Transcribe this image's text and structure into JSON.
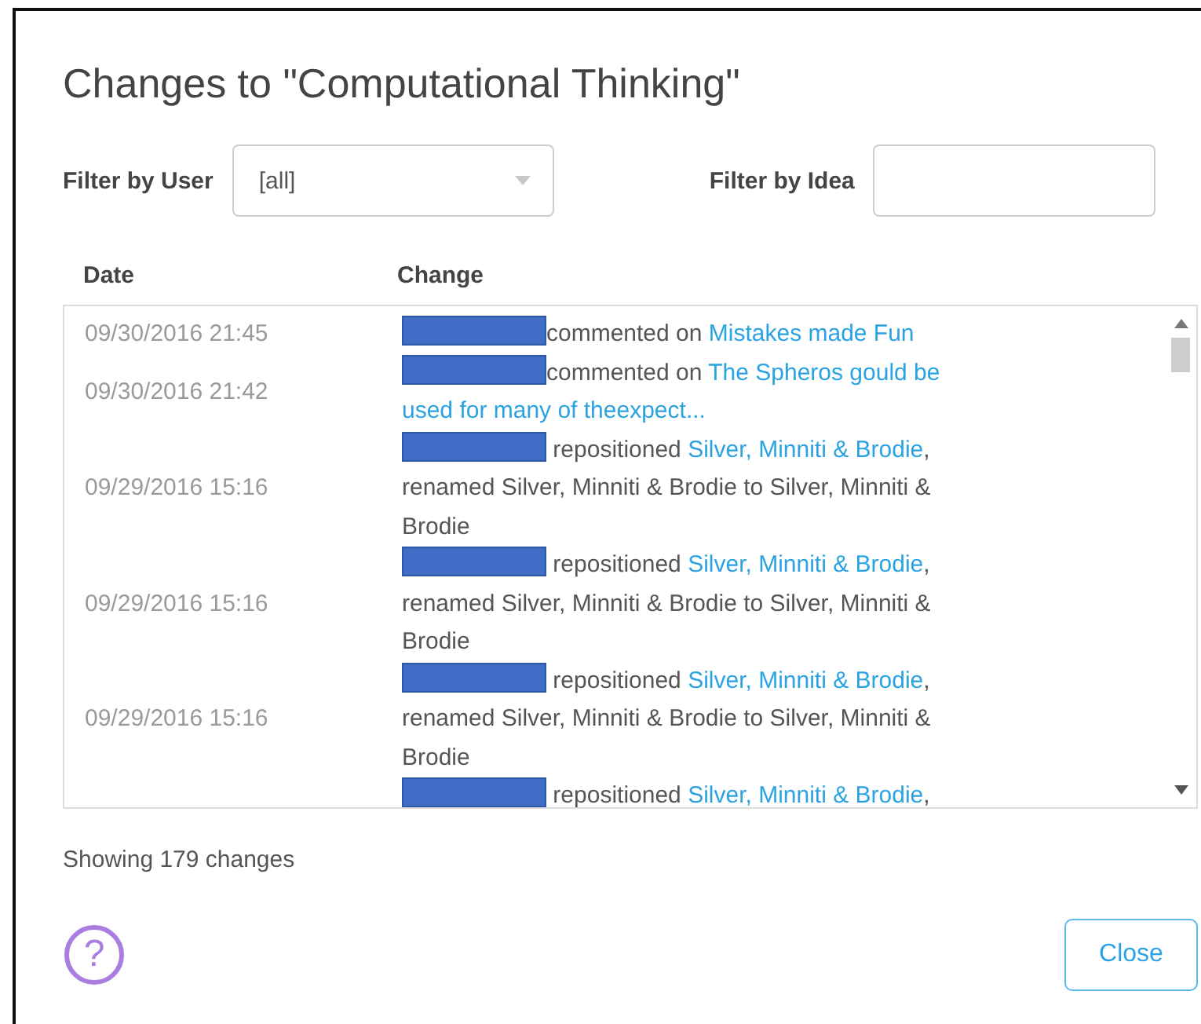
{
  "dialog": {
    "title": "Changes to \"Computational Thinking\"",
    "filters": {
      "user_label": "Filter by User",
      "user_value": "[all]",
      "idea_label": "Filter by Idea"
    },
    "table": {
      "columns": [
        "Date",
        "Change"
      ],
      "rows": [
        {
          "date": "09/30/2016 21:45",
          "lines": [
            [
              {
                "kind": "redacted"
              },
              {
                "kind": "text",
                "text": "commented on "
              },
              {
                "kind": "link",
                "text": "Mistakes made Fun"
              }
            ]
          ]
        },
        {
          "date": "09/30/2016 21:42",
          "lines": [
            [
              {
                "kind": "redacted"
              },
              {
                "kind": "text",
                "text": "commented on "
              },
              {
                "kind": "link",
                "text": "The Spheros gould be"
              }
            ],
            [
              {
                "kind": "link",
                "text": "used for many of theexpect..."
              }
            ]
          ]
        },
        {
          "date": "09/29/2016 15:16",
          "lines": [
            [
              {
                "kind": "redacted"
              },
              {
                "kind": "text",
                "text": " repositioned "
              },
              {
                "kind": "link",
                "text": "Silver, Minniti & Brodie"
              },
              {
                "kind": "text",
                "text": ","
              }
            ],
            [
              {
                "kind": "text",
                "text": "renamed Silver, Minniti & Brodie to Silver, Minniti &"
              }
            ],
            [
              {
                "kind": "text",
                "text": "Brodie"
              }
            ]
          ]
        },
        {
          "date": "09/29/2016 15:16",
          "lines": [
            [
              {
                "kind": "redacted"
              },
              {
                "kind": "text",
                "text": " repositioned "
              },
              {
                "kind": "link",
                "text": "Silver, Minniti & Brodie"
              },
              {
                "kind": "text",
                "text": ","
              }
            ],
            [
              {
                "kind": "text",
                "text": "renamed Silver, Minniti & Brodie to Silver, Minniti &"
              }
            ],
            [
              {
                "kind": "text",
                "text": "Brodie"
              }
            ]
          ]
        },
        {
          "date": "09/29/2016 15:16",
          "lines": [
            [
              {
                "kind": "redacted"
              },
              {
                "kind": "text",
                "text": " repositioned "
              },
              {
                "kind": "link",
                "text": "Silver, Minniti & Brodie"
              },
              {
                "kind": "text",
                "text": ","
              }
            ],
            [
              {
                "kind": "text",
                "text": "renamed Silver, Minniti & Brodie to Silver, Minniti &"
              }
            ],
            [
              {
                "kind": "text",
                "text": "Brodie"
              }
            ]
          ]
        },
        {
          "lines": [
            [
              {
                "kind": "redacted"
              },
              {
                "kind": "text",
                "text": " repositioned "
              },
              {
                "kind": "link",
                "text": "Silver, Minniti & Brodie"
              },
              {
                "kind": "text",
                "text": ","
              }
            ]
          ]
        }
      ]
    },
    "status": "Showing 179 changes",
    "help": "?",
    "close_button": "Close"
  }
}
